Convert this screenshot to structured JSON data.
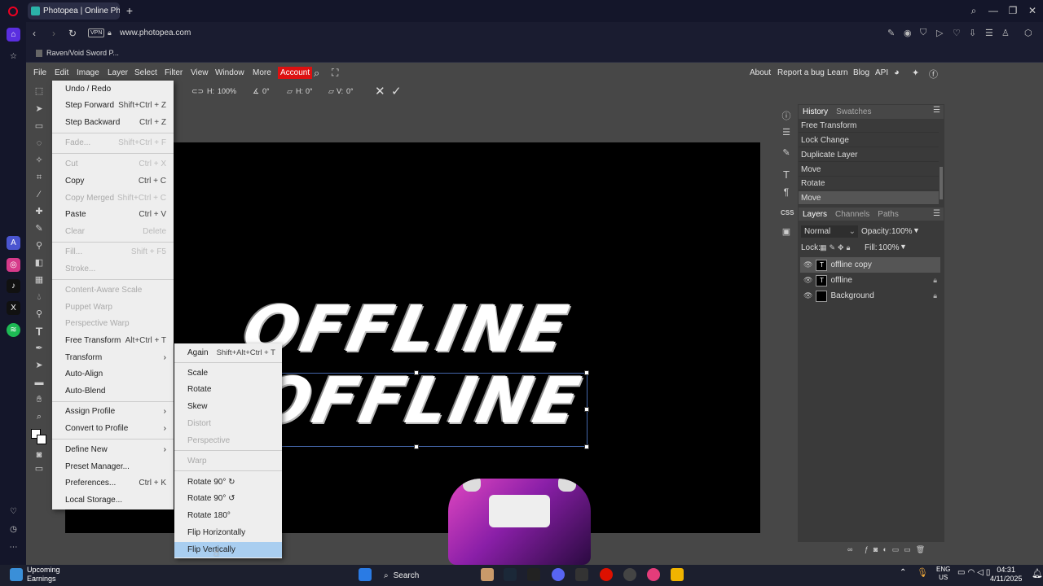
{
  "browser": {
    "tab_title": "Photopea | Online Photo",
    "tab_close": "×",
    "new_tab": "+",
    "vpn_label": "VPN",
    "url": "www.photopea.com",
    "bookmark": "Raven/Void Sword P..."
  },
  "menubar": {
    "items": [
      "File",
      "Edit",
      "Image",
      "Layer",
      "Select",
      "Filter",
      "View",
      "Window",
      "More"
    ],
    "account": "Account",
    "right_items": [
      "About",
      "Report a bug",
      "Learn",
      "Blog",
      "API"
    ]
  },
  "options": {
    "h_label": "H:",
    "h_value": "100%",
    "angle_value": "0°",
    "skew_h_label": "H:",
    "skew_h_value": "0°",
    "skew_v_label": "V:",
    "skew_v_value": "0°"
  },
  "edit_menu": [
    {
      "label": "Undo / Redo",
      "shortcut": "",
      "disabled": false
    },
    {
      "label": "Step Forward",
      "shortcut": "Shift+Ctrl + Z",
      "disabled": false
    },
    {
      "label": "Step Backward",
      "shortcut": "Ctrl + Z",
      "disabled": false
    },
    {
      "label": "Fade...",
      "shortcut": "Shift+Ctrl + F",
      "disabled": true
    },
    {
      "label": "Cut",
      "shortcut": "Ctrl + X",
      "disabled": true
    },
    {
      "label": "Copy",
      "shortcut": "Ctrl + C",
      "disabled": false
    },
    {
      "label": "Copy Merged",
      "shortcut": "Shift+Ctrl + C",
      "disabled": true
    },
    {
      "label": "Paste",
      "shortcut": "Ctrl + V",
      "disabled": false
    },
    {
      "label": "Clear",
      "shortcut": "Delete",
      "disabled": true
    },
    {
      "label": "Fill...",
      "shortcut": "Shift + F5",
      "disabled": true
    },
    {
      "label": "Stroke...",
      "shortcut": "",
      "disabled": true
    },
    {
      "label": "Content-Aware Scale",
      "shortcut": "",
      "disabled": true
    },
    {
      "label": "Puppet Warp",
      "shortcut": "",
      "disabled": true
    },
    {
      "label": "Perspective Warp",
      "shortcut": "",
      "disabled": true
    },
    {
      "label": "Free Transform",
      "shortcut": "Alt+Ctrl + T",
      "disabled": false
    },
    {
      "label": "Transform",
      "shortcut": "",
      "disabled": false
    },
    {
      "label": "Auto-Align",
      "shortcut": "",
      "disabled": false
    },
    {
      "label": "Auto-Blend",
      "shortcut": "",
      "disabled": false
    },
    {
      "label": "Assign Profile",
      "shortcut": "",
      "disabled": false
    },
    {
      "label": "Convert to Profile",
      "shortcut": "",
      "disabled": false
    },
    {
      "label": "Define New",
      "shortcut": "",
      "disabled": false
    },
    {
      "label": "Preset Manager...",
      "shortcut": "",
      "disabled": false
    },
    {
      "label": "Preferences...",
      "shortcut": "Ctrl + K",
      "disabled": false
    },
    {
      "label": "Local Storage...",
      "shortcut": "",
      "disabled": false
    }
  ],
  "submenu_arrow": "›",
  "transform_menu": [
    {
      "label": "Again",
      "shortcut": "Shift+Alt+Ctrl + T",
      "disabled": false
    },
    {
      "label": "Scale",
      "shortcut": "",
      "disabled": false
    },
    {
      "label": "Rotate",
      "shortcut": "",
      "disabled": false
    },
    {
      "label": "Skew",
      "shortcut": "",
      "disabled": false
    },
    {
      "label": "Distort",
      "shortcut": "",
      "disabled": true
    },
    {
      "label": "Perspective",
      "shortcut": "",
      "disabled": true
    },
    {
      "label": "Warp",
      "shortcut": "",
      "disabled": true
    },
    {
      "label": "Rotate 90° ↻",
      "shortcut": "",
      "disabled": false
    },
    {
      "label": "Rotate 90° ↺",
      "shortcut": "",
      "disabled": false
    },
    {
      "label": "Rotate 180°",
      "shortcut": "",
      "disabled": false
    },
    {
      "label": "Flip Horizontally",
      "shortcut": "",
      "disabled": false
    },
    {
      "label": "Flip Vertically",
      "shortcut": "",
      "disabled": false,
      "highlighted": true
    }
  ],
  "canvas": {
    "text_top": "OFFLINE",
    "text_bottom": "OFFLINE"
  },
  "history": {
    "tabs": [
      "History",
      "Swatches"
    ],
    "items": [
      "Free Transform",
      "Lock Change",
      "Duplicate Layer",
      "Move",
      "Rotate",
      "Move"
    ]
  },
  "layers": {
    "tabs": [
      "Layers",
      "Channels",
      "Paths"
    ],
    "blend_mode": "Normal",
    "opacity_label": "Opacity:",
    "opacity": "100%",
    "lock_label": "Lock:",
    "fill_label": "Fill:",
    "fill": "100%",
    "items": [
      {
        "name": "offline copy",
        "thumb": "T",
        "locked": false
      },
      {
        "name": "offline",
        "thumb": "T",
        "locked": true
      },
      {
        "name": "Background",
        "thumb": "",
        "locked": true
      }
    ]
  },
  "taskbar": {
    "weather_line1": "Upcoming",
    "weather_line2": "Earnings",
    "search": "Search",
    "lang_line1": "ENG",
    "lang_line2": "US",
    "time": "04:31",
    "date": "4/11/2025"
  }
}
